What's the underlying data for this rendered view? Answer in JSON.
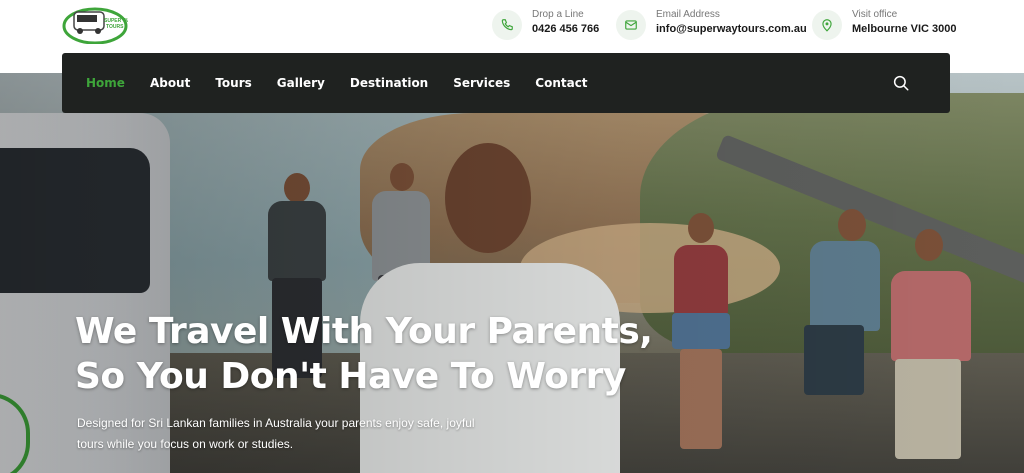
{
  "logo": {
    "text": "SUPER WAY TOURS",
    "brand_color": "#3ea53a"
  },
  "contacts": [
    {
      "icon": "phone-icon",
      "label": "Drop a Line",
      "value": "0426 456 766"
    },
    {
      "icon": "mail-icon",
      "label": "Email Address",
      "value": "info@superwaytours.com.au"
    },
    {
      "icon": "map-pin-icon",
      "label": "Visit office",
      "value": "Melbourne VIC 3000"
    }
  ],
  "nav": {
    "items": [
      "Home",
      "About",
      "Tours",
      "Gallery",
      "Destination",
      "Services",
      "Contact"
    ],
    "active": "Home",
    "search_icon": "search-icon"
  },
  "hero": {
    "headline_line1": "We Travel With Your Parents,",
    "headline_line2": "So You Don't Have To Worry",
    "sub_line1": "Designed for Sri Lankan families in Australia your parents enjoy safe, joyful",
    "sub_line2": "tours while you focus on work or studies."
  },
  "colors": {
    "accent": "#3ea53a",
    "nav_bg": "#1f2220"
  }
}
